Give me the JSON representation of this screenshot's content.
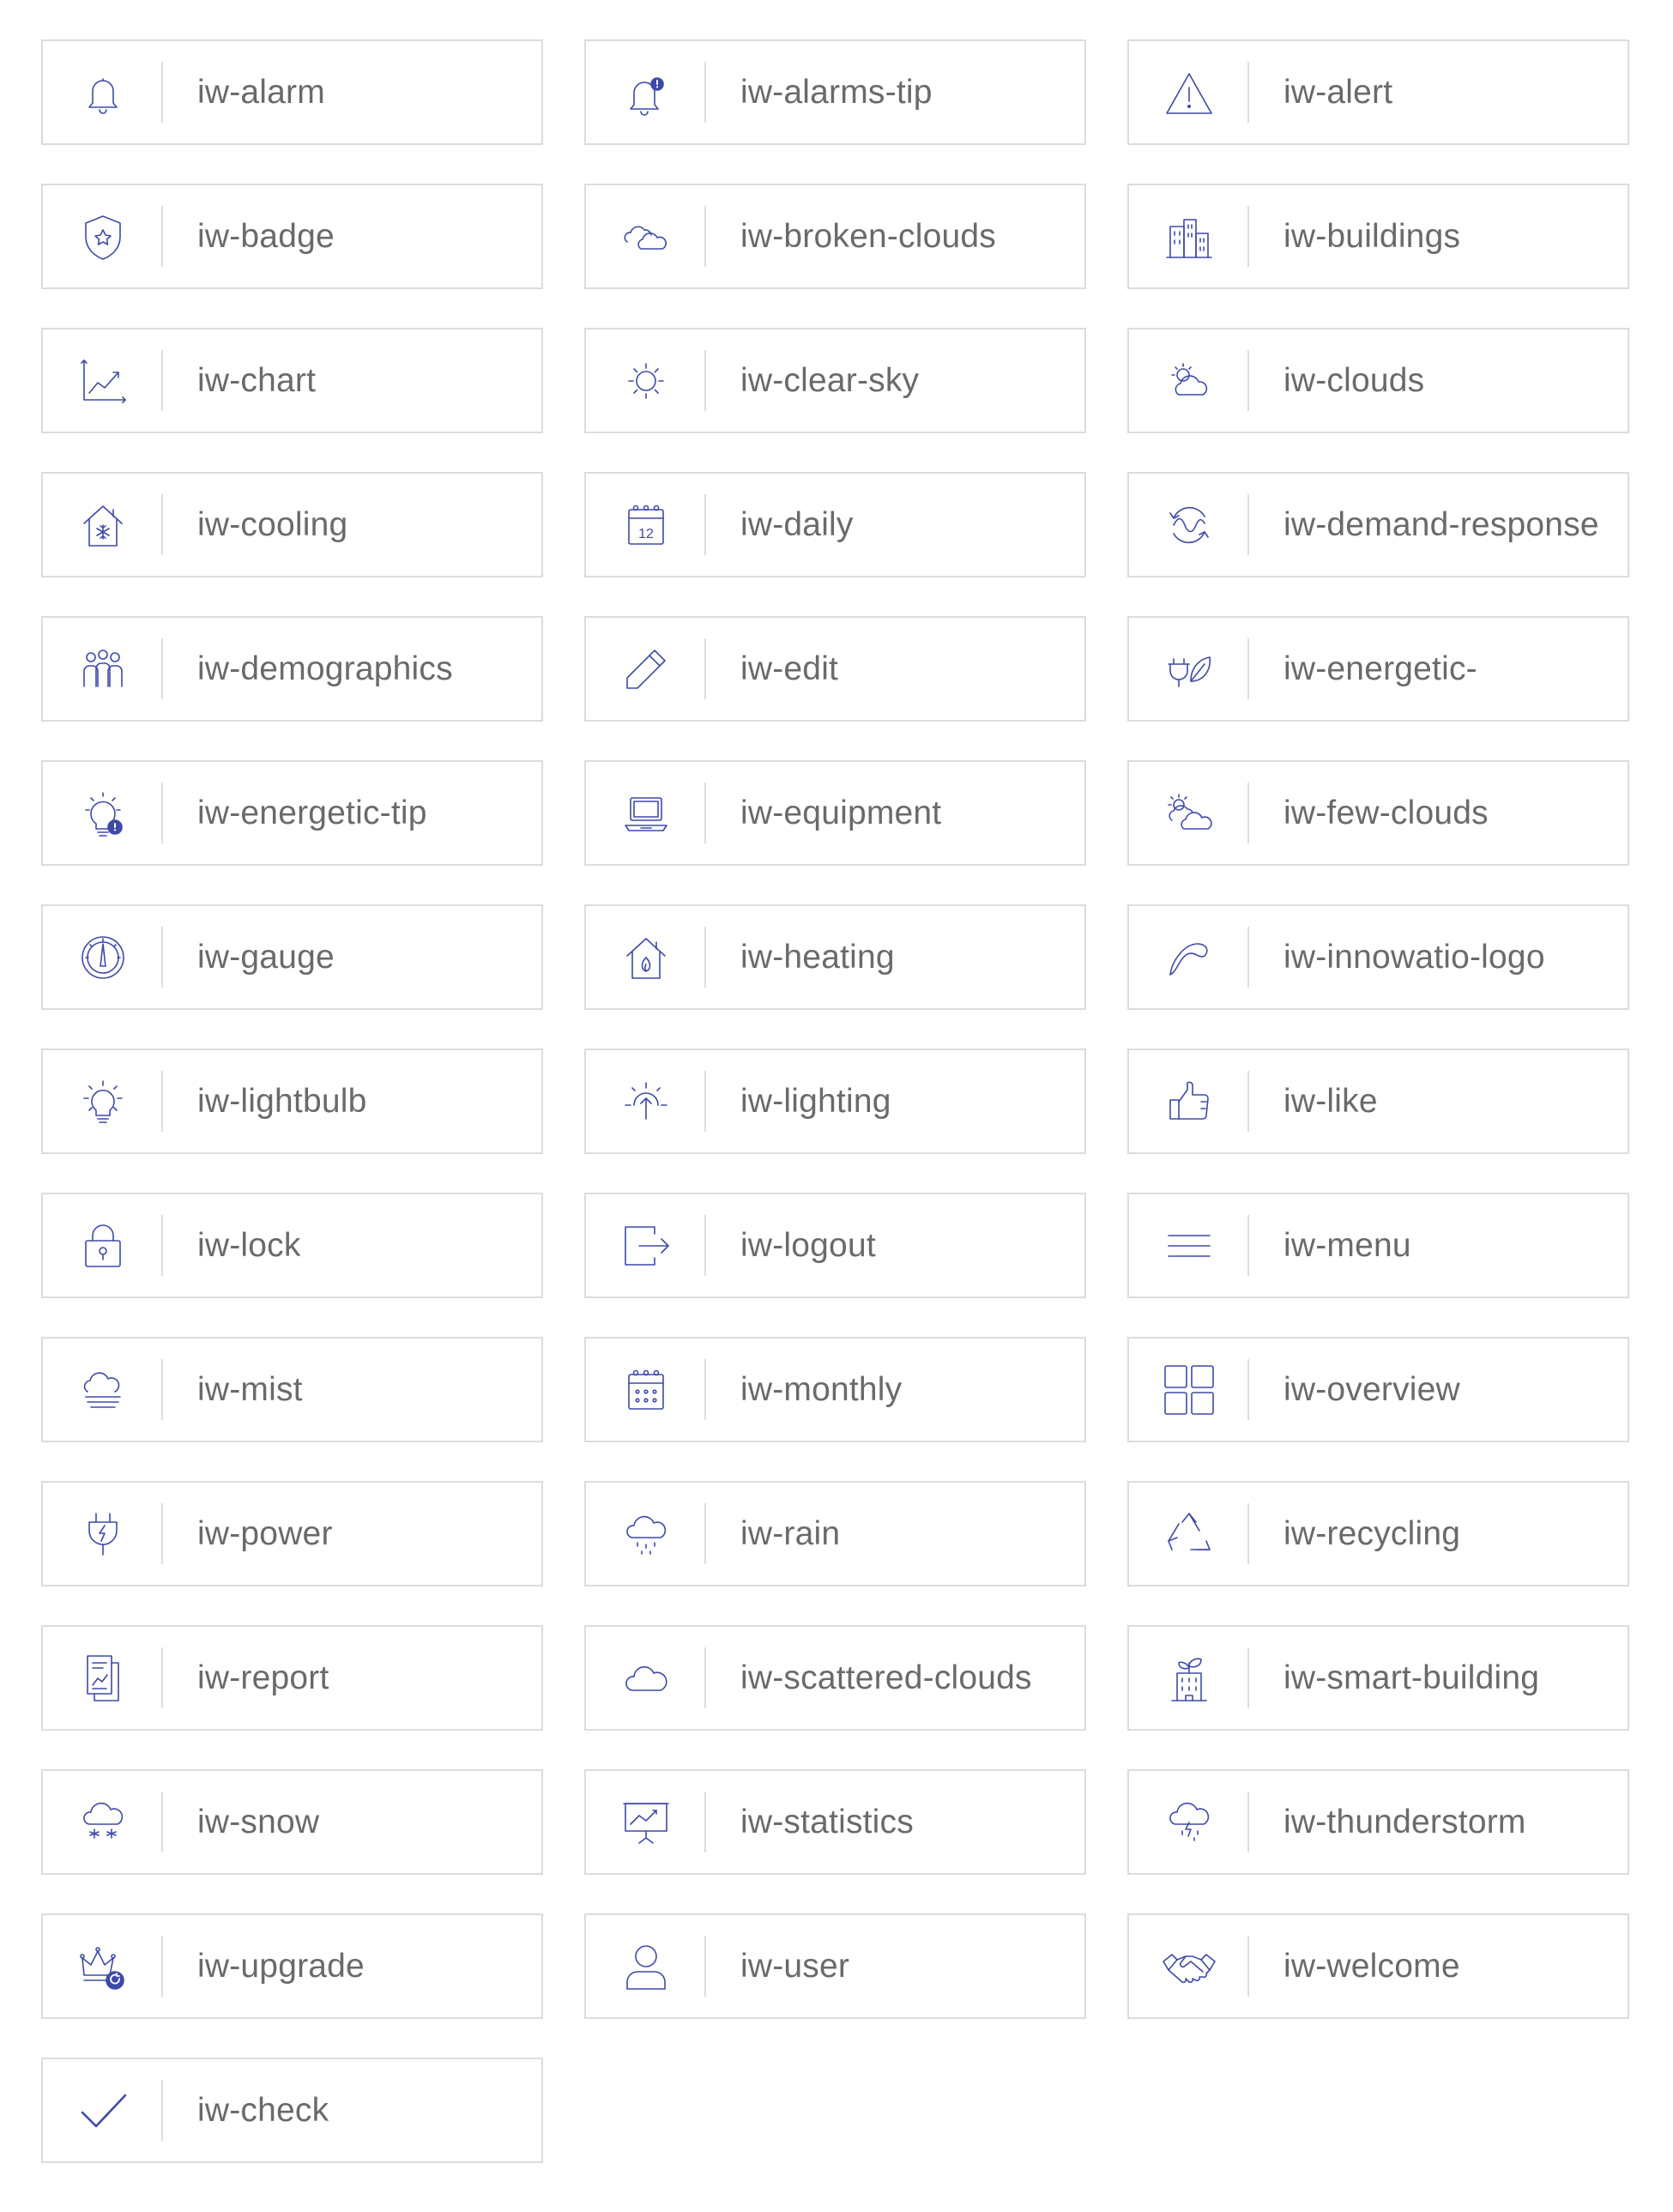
{
  "icons": [
    {
      "label": "iw-alarm",
      "icon": "bell-icon"
    },
    {
      "label": "iw-alarms-tip",
      "icon": "bell-alert-icon"
    },
    {
      "label": "iw-alert",
      "icon": "warning-triangle-icon"
    },
    {
      "label": "iw-badge",
      "icon": "shield-star-icon"
    },
    {
      "label": "iw-broken-clouds",
      "icon": "broken-clouds-icon"
    },
    {
      "label": "iw-buildings",
      "icon": "buildings-icon"
    },
    {
      "label": "iw-chart",
      "icon": "line-chart-icon"
    },
    {
      "label": "iw-clear-sky",
      "icon": "sun-icon"
    },
    {
      "label": "iw-clouds",
      "icon": "sun-cloud-icon"
    },
    {
      "label": "iw-cooling",
      "icon": "house-snowflake-icon"
    },
    {
      "label": "iw-daily",
      "icon": "calendar-day-icon"
    },
    {
      "label": "iw-demand-response",
      "icon": "wave-cycle-icon"
    },
    {
      "label": "iw-demographics",
      "icon": "people-group-icon"
    },
    {
      "label": "iw-edit",
      "icon": "pencil-icon"
    },
    {
      "label": "iw-energetic-",
      "icon": "plug-leaf-icon"
    },
    {
      "label": "iw-energetic-tip",
      "icon": "lightbulb-alert-icon"
    },
    {
      "label": "iw-equipment",
      "icon": "laptop-icon"
    },
    {
      "label": "iw-few-clouds",
      "icon": "few-clouds-icon"
    },
    {
      "label": "iw-gauge",
      "icon": "gauge-icon"
    },
    {
      "label": "iw-heating",
      "icon": "house-flame-icon"
    },
    {
      "label": "iw-innowatio-logo",
      "icon": "innowatio-logo-icon"
    },
    {
      "label": "iw-lightbulb",
      "icon": "lightbulb-icon"
    },
    {
      "label": "iw-lighting",
      "icon": "sunrise-arrow-icon"
    },
    {
      "label": "iw-like",
      "icon": "thumbs-up-icon"
    },
    {
      "label": "iw-lock",
      "icon": "lock-icon"
    },
    {
      "label": "iw-logout",
      "icon": "logout-arrow-icon"
    },
    {
      "label": "iw-menu",
      "icon": "hamburger-menu-icon"
    },
    {
      "label": "iw-mist",
      "icon": "mist-cloud-icon"
    },
    {
      "label": "iw-monthly",
      "icon": "calendar-month-icon"
    },
    {
      "label": "iw-overview",
      "icon": "grid-squares-icon"
    },
    {
      "label": "iw-power",
      "icon": "plug-bolt-icon"
    },
    {
      "label": "iw-rain",
      "icon": "rain-cloud-icon"
    },
    {
      "label": "iw-recycling",
      "icon": "recycle-icon"
    },
    {
      "label": "iw-report",
      "icon": "report-document-icon"
    },
    {
      "label": "iw-scattered-clouds",
      "icon": "cloud-icon"
    },
    {
      "label": "iw-smart-building",
      "icon": "building-leaf-icon"
    },
    {
      "label": "iw-snow",
      "icon": "snow-cloud-icon"
    },
    {
      "label": "iw-statistics",
      "icon": "presentation-board-icon"
    },
    {
      "label": "iw-thunderstorm",
      "icon": "thunder-cloud-icon"
    },
    {
      "label": "iw-upgrade",
      "icon": "crown-refresh-icon"
    },
    {
      "label": "iw-user",
      "icon": "user-icon"
    },
    {
      "label": "iw-welcome",
      "icon": "handshake-icon"
    },
    {
      "label": "iw-check",
      "icon": "checkmark-icon"
    }
  ],
  "colors": {
    "icon": "#3d4aa8",
    "label": "#6a6a6a",
    "border": "#dcdcdc"
  }
}
